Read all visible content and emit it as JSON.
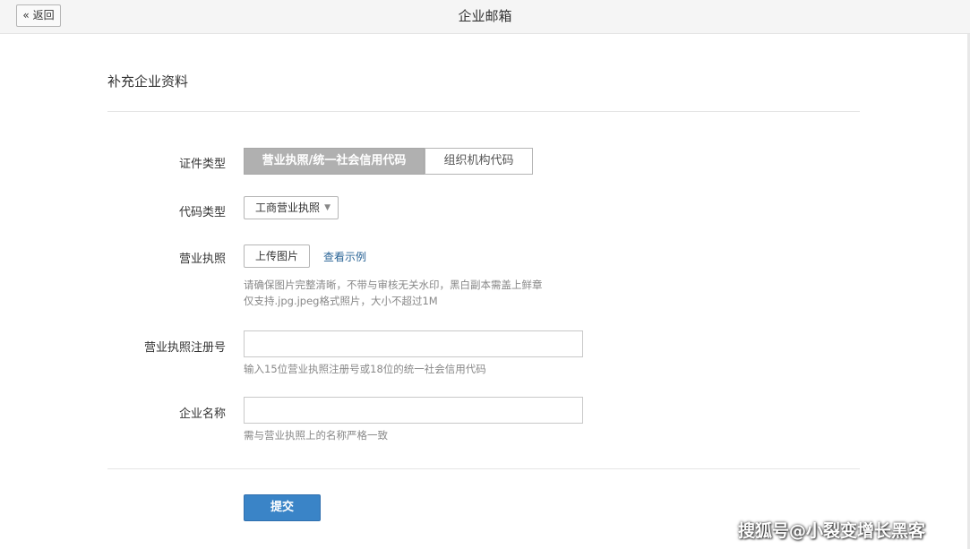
{
  "header": {
    "back_label": "« 返回",
    "title": "企业邮箱"
  },
  "form": {
    "section_title": "补充企业资料",
    "cert_type": {
      "label": "证件类型",
      "options": [
        "营业执照/统一社会信用代码",
        "组织机构代码"
      ],
      "selected": "营业执照/统一社会信用代码"
    },
    "code_type": {
      "label": "代码类型",
      "value": "工商营业执照"
    },
    "license": {
      "label": "营业执照",
      "upload_label": "上传图片",
      "example_link": "查看示例",
      "hint_line1": "请确保图片完整清晰，不带与审核无关水印，黑白副本需盖上鲜章",
      "hint_line2": "仅支持.jpg.jpeg格式照片，大小不超过1M"
    },
    "reg_number": {
      "label": "营业执照注册号",
      "value": "",
      "hint": "输入15位营业执照注册号或18位的统一社会信用代码"
    },
    "company_name": {
      "label": "企业名称",
      "value": "",
      "hint": "需与营业执照上的名称严格一致"
    },
    "submit_label": "提交"
  },
  "watermark": "搜狐号@小裂变增长黑客",
  "colors": {
    "primary_button": "#3a84c7",
    "active_segment": "#b0b0b0",
    "link": "#2a6496"
  }
}
